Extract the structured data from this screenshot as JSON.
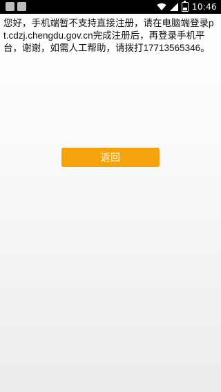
{
  "status_bar": {
    "time": "10:46",
    "icons": [
      "notification-icon",
      "notification-icon",
      "wifi-icon",
      "signal-icon",
      "battery-icon"
    ]
  },
  "main": {
    "message": "您好，手机端暂不支持直接注册，请在电脑端登录pt.cdzj.chengdu.gov.cn完成注册后，再登录手机平台，谢谢，如需人工帮助，请拨打17713565346。",
    "back_button_label": "返回"
  },
  "colors": {
    "button_background": "#f5a20f",
    "button_text": "#ffffff",
    "status_bar_background": "#000000"
  }
}
